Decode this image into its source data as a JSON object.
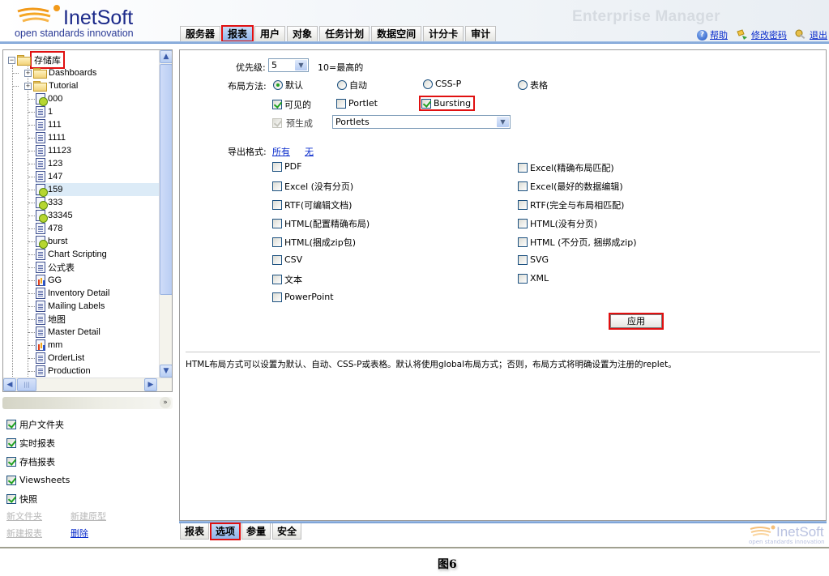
{
  "header": {
    "logo_name": "InetSoft",
    "logo_tagline": "open standards innovation",
    "app_title": "Enterprise Manager",
    "top_tabs": [
      {
        "label": "服务器",
        "active": false
      },
      {
        "label": "报表",
        "active": true
      },
      {
        "label": "用户",
        "active": false
      },
      {
        "label": "对象",
        "active": false
      },
      {
        "label": "任务计划",
        "active": false
      },
      {
        "label": "数据空间",
        "active": false
      },
      {
        "label": "计分卡",
        "active": false
      },
      {
        "label": "审计",
        "active": false
      }
    ],
    "links": [
      {
        "icon": "help-icon",
        "label": "帮助"
      },
      {
        "icon": "change-password-icon",
        "label": "修改密码"
      },
      {
        "icon": "logout-key-icon",
        "label": "退出"
      }
    ]
  },
  "tree": {
    "root": {
      "label": "存储库",
      "expanded": true
    },
    "items": [
      {
        "label": "Dashboards",
        "type": "folder",
        "expandable": true
      },
      {
        "label": "Tutorial",
        "type": "folder",
        "expandable": true
      },
      {
        "label": "000",
        "type": "scheduled-report"
      },
      {
        "label": "1",
        "type": "report"
      },
      {
        "label": "111",
        "type": "report"
      },
      {
        "label": "1111",
        "type": "report"
      },
      {
        "label": "11123",
        "type": "report"
      },
      {
        "label": "123",
        "type": "report"
      },
      {
        "label": "147",
        "type": "report"
      },
      {
        "label": "159",
        "type": "scheduled-report",
        "selected": true
      },
      {
        "label": "333",
        "type": "scheduled-report"
      },
      {
        "label": "33345",
        "type": "scheduled-report"
      },
      {
        "label": "478",
        "type": "report"
      },
      {
        "label": "burst",
        "type": "scheduled-report"
      },
      {
        "label": "Chart Scripting",
        "type": "report"
      },
      {
        "label": "公式表",
        "type": "report"
      },
      {
        "label": "GG",
        "type": "chart-report"
      },
      {
        "label": "Inventory Detail",
        "type": "report"
      },
      {
        "label": "Mailing Labels",
        "type": "report"
      },
      {
        "label": "地图",
        "type": "report"
      },
      {
        "label": "Master Detail",
        "type": "report"
      },
      {
        "label": "mm",
        "type": "chart-report"
      },
      {
        "label": "OrderList",
        "type": "report"
      },
      {
        "label": "Production",
        "type": "report"
      }
    ]
  },
  "filters": [
    {
      "label": "用户文件夹",
      "checked": true
    },
    {
      "label": "实时报表",
      "checked": true
    },
    {
      "label": "存档报表",
      "checked": true
    },
    {
      "label": "Viewsheets",
      "checked": true
    },
    {
      "label": "快照",
      "checked": true
    }
  ],
  "sidebar_actions": {
    "new_folder": "新文件夹",
    "new_prototype": "新建原型",
    "new_report": "新建报表",
    "delete": "删除"
  },
  "options": {
    "priority_label": "优先级:",
    "priority_value": "5",
    "priority_hint": "10=最高的",
    "layout_label": "布局方法:",
    "layout_options": [
      {
        "label": "默认",
        "checked": true
      },
      {
        "label": "自动",
        "checked": false
      },
      {
        "label": "CSS-P",
        "checked": false
      },
      {
        "label": "表格",
        "checked": false
      }
    ],
    "visible": {
      "label": "可见的",
      "checked": true
    },
    "portlet": {
      "label": "Portlet",
      "checked": false
    },
    "bursting": {
      "label": "Bursting",
      "checked": true
    },
    "pregenerate": {
      "label": "预生成",
      "checked": true,
      "disabled": true
    },
    "portlets_select": "Portlets",
    "export_label": "导出格式:",
    "export_all": "所有",
    "export_none": "无",
    "export_formats_left": [
      {
        "label": "PDF",
        "checked": false
      },
      {
        "label": "Excel (没有分页)",
        "checked": false
      },
      {
        "label": "RTF(可编辑文档)",
        "checked": false
      },
      {
        "label": "HTML(配置精确布局)",
        "checked": false
      },
      {
        "label": "HTML(捆成zip包)",
        "checked": false
      },
      {
        "label": "CSV",
        "checked": false
      },
      {
        "label": "文本",
        "checked": false
      },
      {
        "label": "PowerPoint",
        "checked": false
      }
    ],
    "export_formats_right": [
      {
        "label": "Excel(精确布局匹配)",
        "checked": false
      },
      {
        "label": "Excel(最好的数据编辑)",
        "checked": false
      },
      {
        "label": "RTF(完全与布局相匹配)",
        "checked": false
      },
      {
        "label": "HTML(没有分页)",
        "checked": false
      },
      {
        "label": "HTML (不分页, 捆绑成zip)",
        "checked": false
      },
      {
        "label": "SVG",
        "checked": false
      },
      {
        "label": "XML",
        "checked": false
      }
    ],
    "apply_button": "应用",
    "help_text": "HTML布局方式可以设置为默认、自动、CSS-P或表格。默认将使用global布局方式；否则，布局方式将明确设置为注册的replet。"
  },
  "bottom_tabs": [
    {
      "label": "报表",
      "active": false
    },
    {
      "label": "选项",
      "active": true
    },
    {
      "label": "参量",
      "active": false
    },
    {
      "label": "安全",
      "active": false
    }
  ],
  "footer": {
    "logo_name": "InetSoft",
    "logo_tagline": "open standards innovation"
  },
  "caption": "图6",
  "colors": {
    "highlight_red": "#e01010",
    "link_blue": "#0a2ccc",
    "active_tab_blue": "#8fb5ea",
    "header_rule": "#6b95cf"
  }
}
